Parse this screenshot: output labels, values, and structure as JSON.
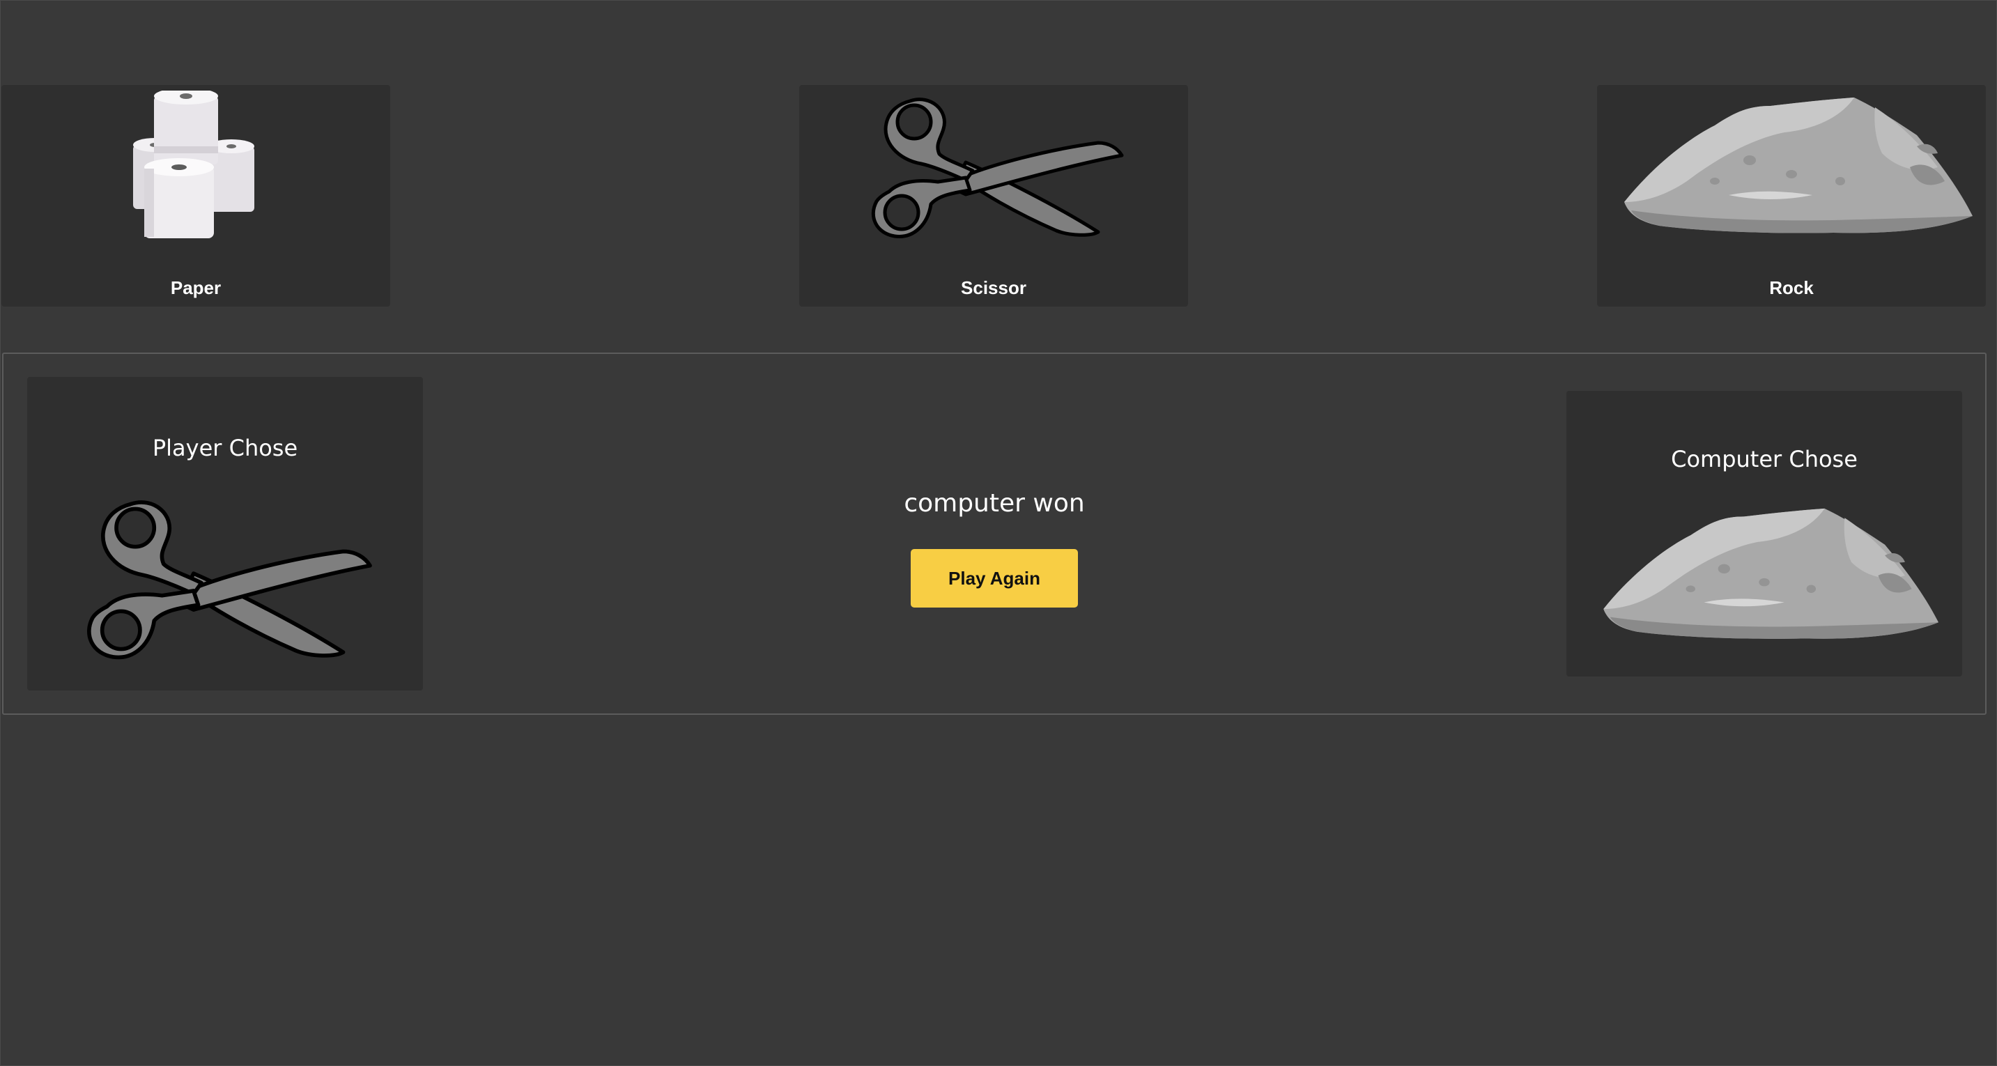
{
  "choices": [
    {
      "label": "Paper",
      "icon": "toilet-paper-icon"
    },
    {
      "label": "Scissor",
      "icon": "scissors-icon"
    },
    {
      "label": "Rock",
      "icon": "rock-icon"
    }
  ],
  "result": {
    "player_title": "Player Chose",
    "player_icon": "scissors-icon",
    "computer_title": "Computer Chose",
    "computer_icon": "rock-icon",
    "message": "computer won",
    "play_again_label": "Play Again"
  },
  "colors": {
    "background": "#393939",
    "card": "#2f2f2f",
    "button": "#f8ce44"
  }
}
